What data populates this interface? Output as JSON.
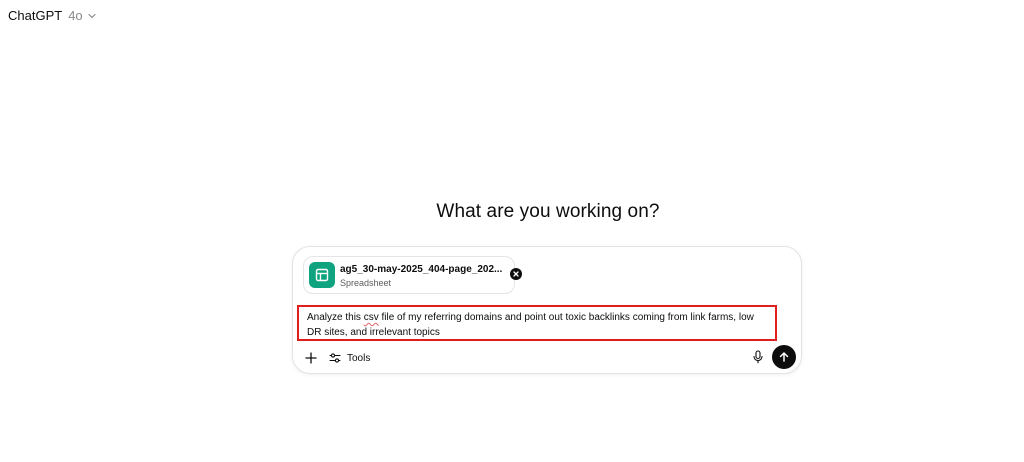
{
  "header": {
    "model_name": "ChatGPT",
    "model_version": "4o"
  },
  "main": {
    "heading": "What are you working on?"
  },
  "composer": {
    "attachment": {
      "file_name": "ag5_30-may-2025_404-page_202...",
      "file_type": "Spreadsheet"
    },
    "prompt": {
      "part1": "Analyze this ",
      "csv": "csv",
      "part2": " file of my referring domains and point out toxic backlinks coming from link farms, low DR sites, and irrelevant topics"
    },
    "tools_label": "Tools"
  },
  "colors": {
    "accent_green": "#10a37f",
    "highlight_red": "#e01e1e",
    "send_button": "#0d0d0d"
  },
  "icons": {
    "model_dropdown": "chevron-down-icon",
    "file": "spreadsheet-icon",
    "remove": "close-icon",
    "plus": "plus-icon",
    "tools": "sliders-icon",
    "mic": "microphone-icon",
    "send": "arrow-up-icon"
  }
}
